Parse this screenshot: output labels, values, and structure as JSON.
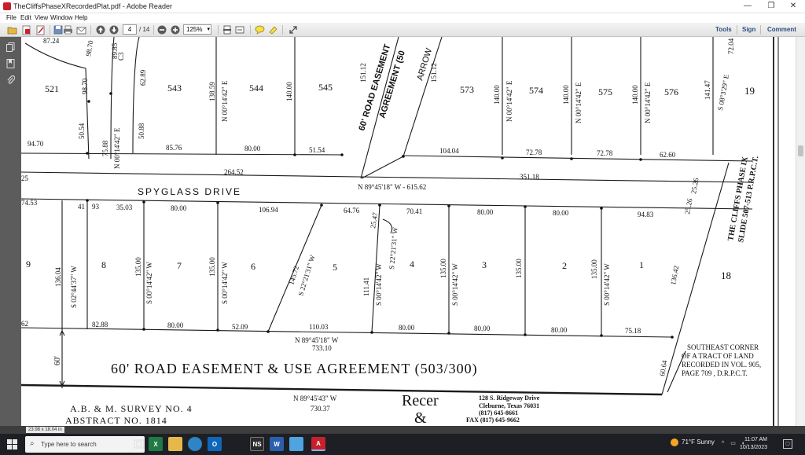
{
  "window": {
    "title": "TheCliffsPhaseXRecordedPlat.pdf - Adobe Reader",
    "controls": {
      "minimize": "—",
      "restore": "❐",
      "close": "✕"
    }
  },
  "menu": [
    "File",
    "Edit",
    "View",
    "Window",
    "Help"
  ],
  "toolbar": {
    "page_current": "4",
    "page_total": "/ 14",
    "zoom": "125%",
    "right_links": [
      "Tools",
      "Sign",
      "Comment"
    ]
  },
  "status": {
    "page_size": "23.98 x 18.04 in"
  },
  "taskbar": {
    "search_placeholder": "Type here to search",
    "weather": "71°F  Sunny",
    "time": "11:07 AM",
    "date": "10/13/2023",
    "apps": [
      "task-view",
      "excel",
      "file-explorer",
      "edge",
      "outlook",
      "ns",
      "word",
      "paint",
      "adobe-reader"
    ]
  },
  "plat": {
    "lots_north": [
      "521",
      "543",
      "544",
      "545",
      "573",
      "574",
      "575",
      "576"
    ],
    "lots_south": [
      "9",
      "8",
      "7",
      "6",
      "5",
      "4",
      "3",
      "2",
      "1"
    ],
    "blocks": [
      "19",
      "18"
    ],
    "street": "SPYGLASS DRIVE",
    "road_top": "60' ROAD EASEMENT",
    "road_top2": "AGREEMENT (50",
    "arrow_street": "ARROW",
    "easement_main": "60' ROAD EASEMENT & USE AGREEMENT (503/300)",
    "easement_width": "60'",
    "adjacent": [
      "THE CLIFFS PHASE IX",
      "SLIDE 507-513 P.R.P.C.T."
    ],
    "southeast_corner": [
      "SOUTHEAST CORNER",
      "OF A TRACT OF LAND",
      "RECORDED IN VOL. 905,",
      "PAGE 709 , D.R.P.C.T."
    ],
    "survey": [
      "A.B. & M. SURVEY NO. 4",
      "ABSTRACT NO. 1814"
    ],
    "surveyor_name": "Recer",
    "surveyor_amp": "&",
    "surveyor_addr": [
      "128 S. Ridgeway Drive",
      "Cleburne, Texas 76031",
      "(817) 645-8661"
    ],
    "surveyor_fax": "FAX (817) 645-9662",
    "bearings": {
      "n_e_1": "N 00°14'42\" E",
      "s_w_1": "S 00°14'42\" W",
      "s_w_2": "S 02°44'37\" W",
      "s_w_3": "S 22°21'31\" W",
      "s_e_1": "S 08°3'29\" E",
      "spyglass_centerline": "N 89°45'18\" W - 615.62",
      "south_line": "N 89°45'18\" W",
      "south_line_len": "733.10",
      "bottom_line": "N 89°45'43\" W",
      "bottom_line_len": "730.37"
    },
    "dims": {
      "top_left": "87.24",
      "left_arc": [
        "98.70",
        "89.85",
        "62.89"
      ],
      "c3": "C3",
      "north_lots_depth": [
        "138.59",
        "140.00",
        "151.12",
        "140.00",
        "140.00",
        "140.00",
        "141.47"
      ],
      "left_50": [
        "50.54",
        "75.88",
        "50.88"
      ],
      "north_row": [
        "94.70",
        "85.76",
        "80.00",
        "51.54",
        "104.04",
        "72.78",
        "72.78",
        "62.60"
      ],
      "row_264": "264.52",
      "row_351": "351.18",
      "south_top": [
        "74.53",
        "41",
        "93",
        "35.03",
        "80.00",
        "106.94",
        "64.76",
        "70.41",
        "80.00",
        "80.00",
        "94.83"
      ],
      "arc_2547": "25.47",
      "right_2526": [
        "25.26",
        "25.26"
      ],
      "right_7204": "72.04",
      "south_depth": [
        "136.04",
        "135.00",
        "135.00",
        "145.72",
        "111.41",
        "135.00",
        "135.00",
        "135.00",
        "136.42"
      ],
      "south_bottom": [
        "62",
        "82.88",
        "80.00",
        "52.09",
        "110.03",
        "80.00",
        "80.00",
        "80.00",
        "75.18"
      ],
      "right_6064": "60.64",
      "dim_25": "25"
    }
  }
}
